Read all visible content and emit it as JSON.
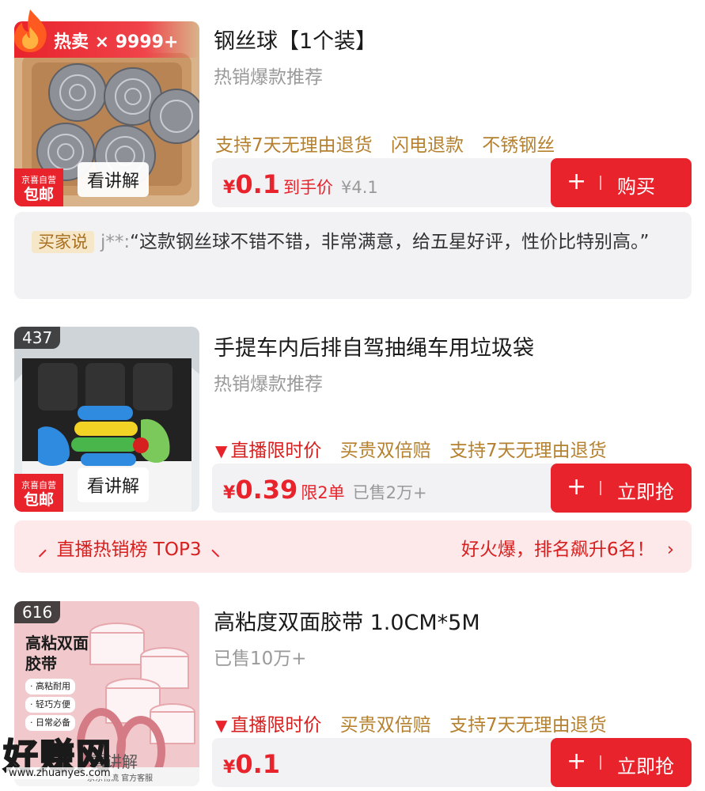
{
  "items": [
    {
      "hot_label": "热卖 × 9999+",
      "jd_badge_top": "京喜自营",
      "jd_badge_bottom": "包邮",
      "explain": "看讲解",
      "title": "钢丝球【1个装】",
      "subtitle": "热销爆款推荐",
      "tags": [
        "支持7天无理由退货",
        "闪电退款",
        "不锈钢丝"
      ],
      "price_symbol": "¥",
      "price": "0.1",
      "price_note": "到手价",
      "original_price": "¥4.1",
      "button_plus": "+",
      "button_label": "购买"
    },
    {
      "rank_number": "437",
      "jd_badge_top": "京喜自营",
      "jd_badge_bottom": "包邮",
      "explain": "看讲解",
      "title": "手提车内后排自驾抽绳车用垃圾袋",
      "subtitle": "热销爆款推荐",
      "tag_live": "直播限时价",
      "tags": [
        "买贵双倍赔",
        "支持7天无理由退货"
      ],
      "price_symbol": "¥",
      "price": "0.39",
      "price_note": "限2单",
      "sold": "已售2万+",
      "button_plus": "+",
      "button_label": "立即抢"
    },
    {
      "rank_number": "616",
      "image_text_1": "高粘双面",
      "image_text_2": "胶带",
      "image_points": [
        "· 高粘耐用",
        "· 轻巧方便",
        "· 日常必备"
      ],
      "image_footer": "京东物流  官方客服",
      "explain": "看讲解",
      "title": "高粘度双面胶带 1.0CM*5M",
      "subtitle": "已售10万+",
      "tag_live": "直播限时价",
      "tags": [
        "买贵双倍赔",
        "支持7天无理由退货"
      ],
      "price_symbol": "¥",
      "price": "0.1",
      "button_plus": "+",
      "button_label": "立即抢"
    }
  ],
  "review": {
    "who": "买家说",
    "user": "j**:",
    "text": "“这款钢丝球不错不错，非常满意，给五星好评，性价比特别高。”"
  },
  "rank_banner": {
    "left": "直播热销榜 TOP3",
    "right": "好火爆，排名飙升6名！",
    "chevron": "›"
  },
  "watermark": {
    "big": "好赚网",
    "small": "www.zhuanyes.com"
  },
  "colors": {
    "accent": "#e8232c",
    "tag_gold": "#b5812f",
    "grey": "#9a9a9a",
    "price_bg": "#f2f2f4",
    "rank_bg": "#fde8ea"
  }
}
